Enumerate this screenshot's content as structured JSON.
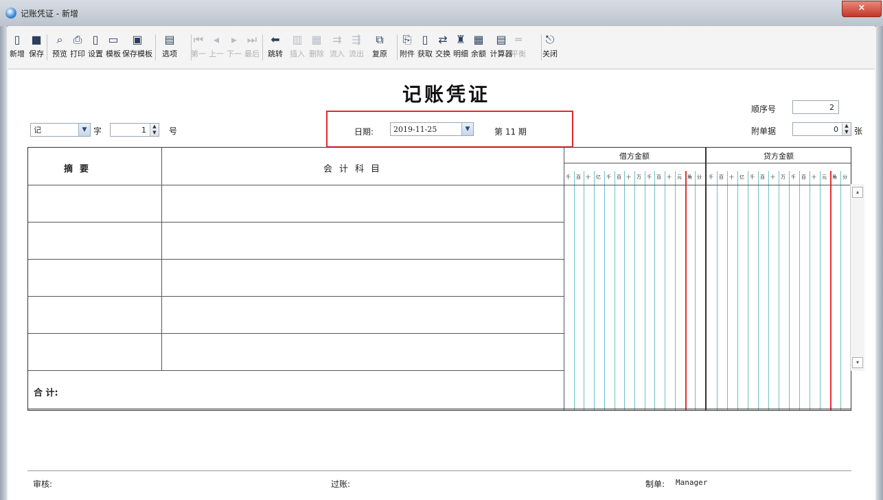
{
  "window": {
    "title": "记账凭证 - 新增",
    "close": "×"
  },
  "toolbar": [
    {
      "label": "新增",
      "icon": "new-document-icon",
      "glyph": "▯",
      "enabled": true
    },
    {
      "label": "保存",
      "icon": "save-icon",
      "glyph": "■",
      "enabled": true
    },
    {
      "label": "预览",
      "icon": "preview-icon",
      "glyph": "⌕",
      "enabled": true
    },
    {
      "label": "打印",
      "icon": "printer-icon",
      "glyph": "⎙",
      "enabled": true
    },
    {
      "label": "设置",
      "icon": "settings-page-icon",
      "glyph": "▯",
      "enabled": true
    },
    {
      "label": "模板",
      "icon": "template-icon",
      "glyph": "▭",
      "enabled": true
    },
    {
      "label": "保存模板",
      "icon": "save-template-icon",
      "glyph": "▣",
      "enabled": true
    },
    {
      "label": "选项",
      "icon": "options-icon",
      "glyph": "▤",
      "enabled": true
    },
    {
      "label": "第一",
      "icon": "first-record-icon",
      "glyph": "⏮",
      "enabled": false
    },
    {
      "label": "上一",
      "icon": "previous-record-icon",
      "glyph": "◂",
      "enabled": false
    },
    {
      "label": "下一",
      "icon": "next-record-icon",
      "glyph": "▸",
      "enabled": false
    },
    {
      "label": "最后",
      "icon": "last-record-icon",
      "glyph": "⏭",
      "enabled": false
    },
    {
      "label": "跳转",
      "icon": "jump-arrow-icon",
      "glyph": "⬅",
      "enabled": true
    },
    {
      "label": "插入",
      "icon": "insert-row-icon",
      "glyph": "▥",
      "enabled": false
    },
    {
      "label": "删除",
      "icon": "delete-row-icon",
      "glyph": "▦",
      "enabled": false
    },
    {
      "label": "流入",
      "icon": "flow-in-icon",
      "glyph": "⇉",
      "enabled": false
    },
    {
      "label": "流出",
      "icon": "flow-out-icon",
      "glyph": "⇶",
      "enabled": false
    },
    {
      "label": "复原",
      "icon": "restore-icon",
      "glyph": "⧉",
      "enabled": true
    },
    {
      "label": "附件",
      "icon": "attachment-icon",
      "glyph": "⎘",
      "enabled": true
    },
    {
      "label": "获取",
      "icon": "fetch-icon",
      "glyph": "▯",
      "enabled": true
    },
    {
      "label": "交换",
      "icon": "exchange-icon",
      "glyph": "⇄",
      "enabled": true
    },
    {
      "label": "明细",
      "icon": "binoculars-icon",
      "glyph": "♜",
      "enabled": true
    },
    {
      "label": "余额",
      "icon": "balance-icon",
      "glyph": "▦",
      "enabled": true
    },
    {
      "label": "计算器",
      "icon": "calculator-icon",
      "glyph": "▤",
      "enabled": true
    },
    {
      "label": "平衡",
      "icon": "balance-equal-icon",
      "glyph": "═",
      "enabled": false
    },
    {
      "label": "关闭",
      "icon": "exit-door-icon",
      "glyph": "⎋",
      "enabled": true
    }
  ],
  "voucher": {
    "title": "记账凭证",
    "word_value": "记",
    "word_label": "字",
    "number_value": "1",
    "number_label": "号",
    "date_label": "日期:",
    "date_value": "2019-11-25",
    "period_label": "第 11 期",
    "seq_label": "顺序号",
    "seq_value": "2",
    "attach_label": "附单据",
    "attach_value": "0",
    "attach_unit": "张"
  },
  "grid": {
    "col_summary": "摘要",
    "col_account": "会计科目",
    "col_debit": "借方金额",
    "col_credit": "贷方金额",
    "units": [
      "千",
      "百",
      "十",
      "亿",
      "千",
      "百",
      "十",
      "万",
      "千",
      "百",
      "十",
      "元",
      "角",
      "分"
    ],
    "rows": [
      {
        "summary": "",
        "account": ""
      },
      {
        "summary": "",
        "account": ""
      },
      {
        "summary": "",
        "account": ""
      },
      {
        "summary": "",
        "account": ""
      },
      {
        "summary": "",
        "account": ""
      }
    ],
    "total_label": "合  计:"
  },
  "footer": {
    "audit_label": "审核:",
    "post_label": "过账:",
    "maker_label": "制单:",
    "maker_value": "Manager"
  },
  "colors": {
    "highlight": "#e0282e",
    "digit_line": "#6cc0c4",
    "yuan_line": "#e03030"
  }
}
